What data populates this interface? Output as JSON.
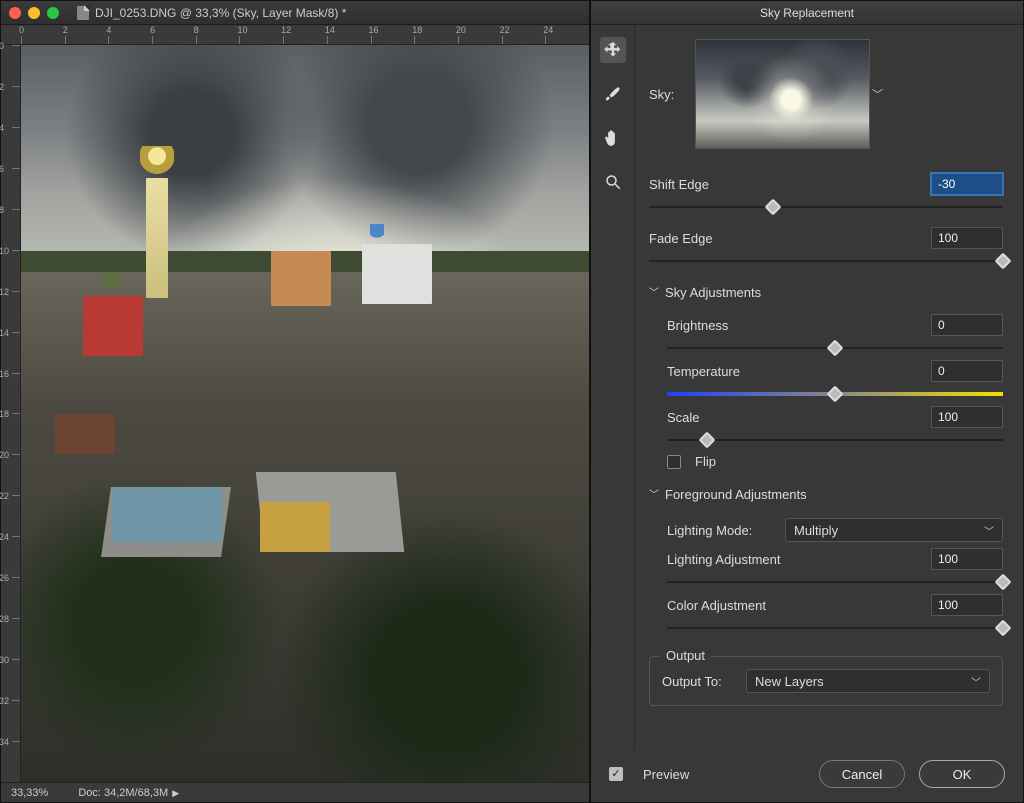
{
  "document": {
    "title": "DJI_0253.DNG @ 33,3% (Sky, Layer Mask/8) *",
    "ruler_h": [
      "0",
      "2",
      "4",
      "6",
      "8",
      "10",
      "12",
      "14",
      "16",
      "18",
      "20",
      "22",
      "24"
    ],
    "ruler_v": [
      "0",
      "2",
      "4",
      "6",
      "8",
      "10",
      "12",
      "14",
      "16",
      "18",
      "20",
      "22",
      "24",
      "26",
      "28",
      "30",
      "32",
      "34"
    ],
    "status_zoom": "33,33%",
    "status_doc": "Doc: 34,2M/68,3M"
  },
  "panel": {
    "title": "Sky Replacement",
    "tools": [
      "move",
      "brush",
      "hand",
      "zoom"
    ],
    "active_tool": "move",
    "sky_label": "Sky:",
    "shift_edge": {
      "label": "Shift Edge",
      "value": "-30",
      "pos": 35
    },
    "fade_edge": {
      "label": "Fade Edge",
      "value": "100",
      "pos": 100
    },
    "section_sky": "Sky Adjustments",
    "brightness": {
      "label": "Brightness",
      "value": "0",
      "pos": 50
    },
    "temperature": {
      "label": "Temperature",
      "value": "0",
      "pos": 50
    },
    "scale": {
      "label": "Scale",
      "value": "100",
      "pos": 12
    },
    "flip_label": "Flip",
    "flip_checked": false,
    "section_fg": "Foreground Adjustments",
    "lighting_mode_label": "Lighting Mode:",
    "lighting_mode_value": "Multiply",
    "lighting_adj": {
      "label": "Lighting Adjustment",
      "value": "100",
      "pos": 100
    },
    "color_adj": {
      "label": "Color Adjustment",
      "value": "100",
      "pos": 100
    },
    "output_legend": "Output",
    "output_to_label": "Output To:",
    "output_to_value": "New Layers",
    "preview_label": "Preview",
    "preview_checked": true,
    "cancel": "Cancel",
    "ok": "OK"
  }
}
